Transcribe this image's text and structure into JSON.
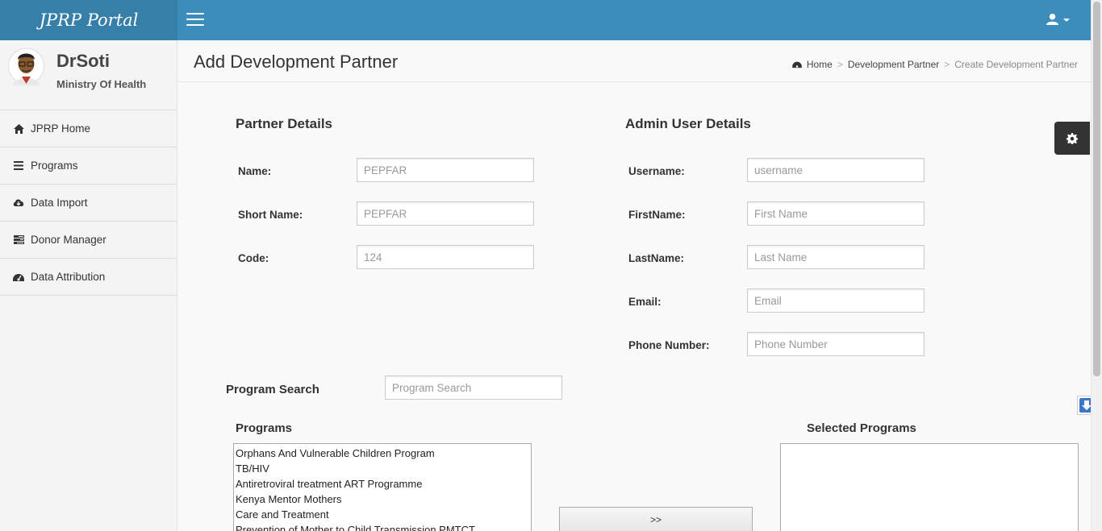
{
  "header": {
    "logo": "JPRP Portal",
    "menu_icon": "hamburger-icon",
    "user_icon": "user-icon"
  },
  "sidebar": {
    "user": {
      "name": "DrSoti",
      "org": "Ministry Of Health"
    },
    "items": [
      {
        "label": "JPRP Home",
        "icon": "home-icon"
      },
      {
        "label": "Programs",
        "icon": "list-icon"
      },
      {
        "label": "Data Import",
        "icon": "cloud-download-icon"
      },
      {
        "label": "Donor Manager",
        "icon": "tasks-icon"
      },
      {
        "label": "Data Attribution",
        "icon": "dashboard-icon"
      }
    ]
  },
  "page": {
    "title": "Add Development Partner",
    "breadcrumb": [
      "Home",
      "Development Partner",
      "Create Development Partner"
    ]
  },
  "partner": {
    "title": "Partner Details",
    "fields": [
      {
        "label": "Name:",
        "placeholder": "PEPFAR"
      },
      {
        "label": "Short Name:",
        "placeholder": "PEPFAR"
      },
      {
        "label": "Code:",
        "placeholder": "124"
      }
    ]
  },
  "admin": {
    "title": "Admin User Details",
    "fields": [
      {
        "label": "Username:",
        "placeholder": "username"
      },
      {
        "label": "FirstName:",
        "placeholder": "First Name"
      },
      {
        "label": "LastName:",
        "placeholder": "Last Name"
      },
      {
        "label": "Email:",
        "placeholder": "Email"
      },
      {
        "label": "Phone Number:",
        "placeholder": "Phone Number"
      }
    ]
  },
  "program_search": {
    "label": "Program Search",
    "placeholder": "Program Search"
  },
  "programs": {
    "title": "Programs",
    "options": [
      "Orphans And Vulnerable Children Program",
      "TB/HIV",
      "Antiretroviral treatment ART Programme",
      "Kenya Mentor Mothers",
      "Care and Treatment",
      "Prevention of Mother to Child Transmission PMTCT"
    ]
  },
  "selected_programs": {
    "title": "Selected Programs",
    "options": []
  },
  "move_button": ">>"
}
